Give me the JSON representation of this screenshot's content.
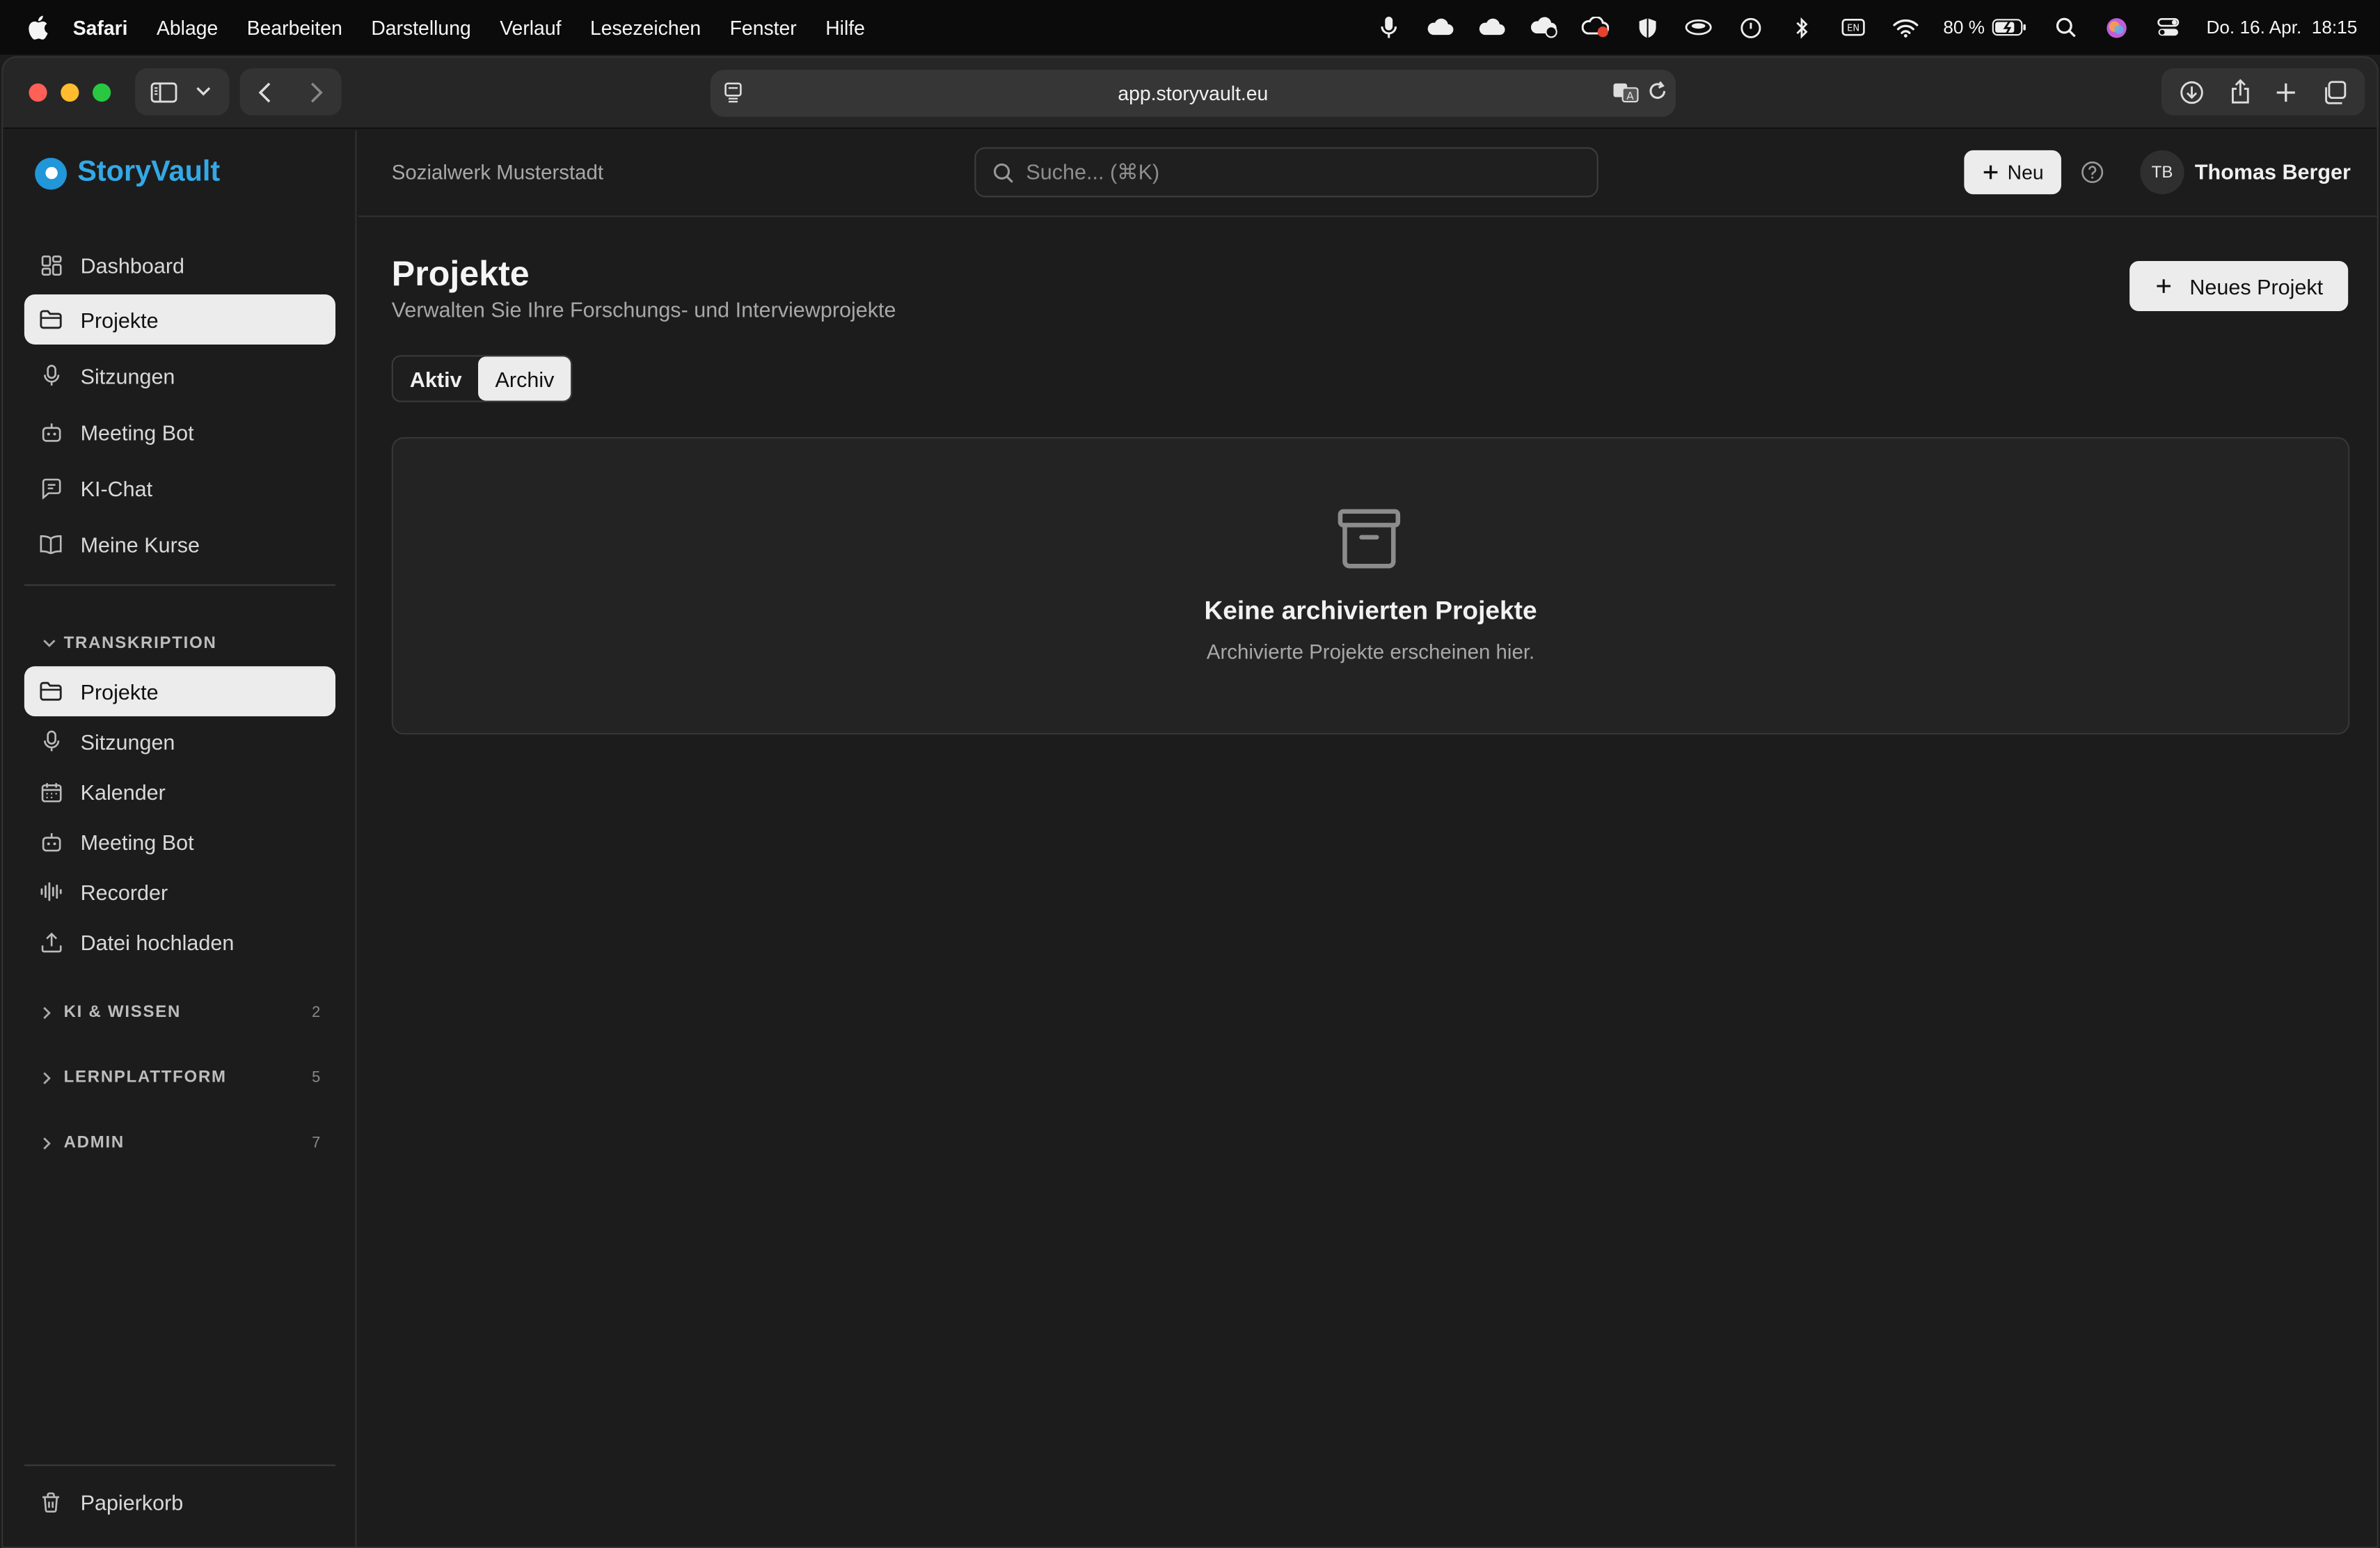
{
  "menubar": {
    "app": "Safari",
    "items": [
      "Ablage",
      "Bearbeiten",
      "Darstellung",
      "Verlauf",
      "Lesezeichen",
      "Fenster",
      "Hilfe"
    ],
    "battery": "80 %",
    "datetime": "Do. 16. Apr.  18:15"
  },
  "browser": {
    "url": "app.storyvault.eu"
  },
  "app": {
    "brand": "StoryVault",
    "org": "Sozialwerk Musterstadt",
    "search_placeholder": "Suche... (⌘K)",
    "new_label": "Neu",
    "user_initials": "TB",
    "user_name": "Thomas Berger"
  },
  "sidebar": {
    "top_items": [
      {
        "label": "Dashboard",
        "icon": "dashboard-icon"
      },
      {
        "label": "Projekte",
        "icon": "folder-icon",
        "active": true
      },
      {
        "label": "Sitzungen",
        "icon": "mic-icon"
      },
      {
        "label": "Meeting Bot",
        "icon": "bot-icon"
      },
      {
        "label": "KI-Chat",
        "icon": "chat-icon"
      },
      {
        "label": "Meine Kurse",
        "icon": "book-icon"
      }
    ],
    "transcription_title": "TRANSKRIPTION",
    "transcription_items": [
      {
        "label": "Projekte",
        "icon": "folder-icon",
        "active": true
      },
      {
        "label": "Sitzungen",
        "icon": "mic-icon"
      },
      {
        "label": "Kalender",
        "icon": "calendar-icon"
      },
      {
        "label": "Meeting Bot",
        "icon": "bot-icon"
      },
      {
        "label": "Recorder",
        "icon": "waveform-icon"
      },
      {
        "label": "Datei hochladen",
        "icon": "upload-icon"
      }
    ],
    "sections": [
      {
        "title": "KI & WISSEN",
        "count": "2"
      },
      {
        "title": "LERNPLATTFORM",
        "count": "5"
      },
      {
        "title": "ADMIN",
        "count": "7"
      }
    ],
    "trash": "Papierkorb"
  },
  "page": {
    "title": "Projekte",
    "subtitle": "Verwalten Sie Ihre Forschungs- und Interviewprojekte",
    "new_project": "Neues Projekt",
    "tabs": [
      "Aktiv",
      "Archiv"
    ],
    "selected_tab": "Archiv",
    "empty_title": "Keine archivierten Projekte",
    "empty_sub": "Archivierte Projekte erscheinen hier."
  },
  "colors": {
    "brand": "#33a9e6",
    "background": "#1c1c1c",
    "active_item": "#ececec"
  }
}
